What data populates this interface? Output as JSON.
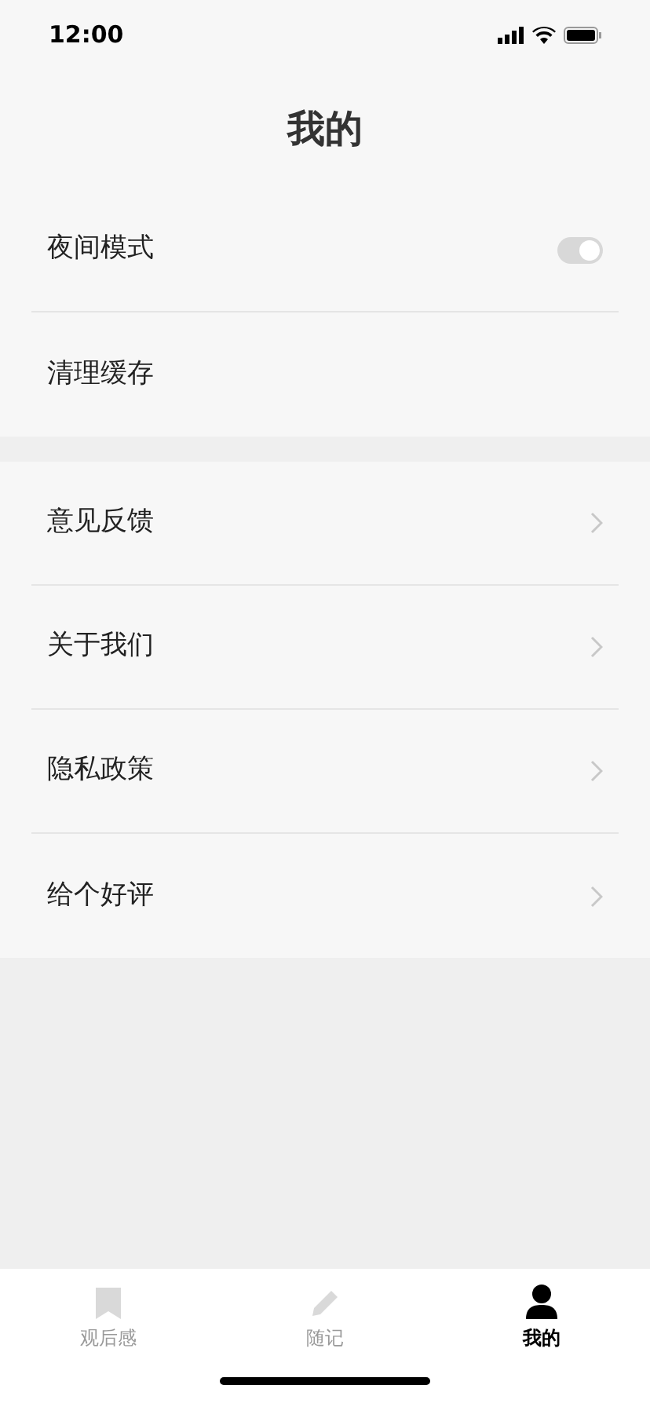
{
  "status_bar": {
    "time": "12:00"
  },
  "title": "我的",
  "sections": [
    {
      "items": [
        {
          "label": "夜间模式",
          "kind": "toggle",
          "on": true
        },
        {
          "label": "清理缓存",
          "kind": "plain"
        }
      ]
    },
    {
      "items": [
        {
          "label": "意见反馈",
          "kind": "link"
        },
        {
          "label": "关于我们",
          "kind": "link"
        },
        {
          "label": "隐私政策",
          "kind": "link"
        },
        {
          "label": "给个好评",
          "kind": "link"
        }
      ]
    }
  ],
  "tab_bar": [
    {
      "label": "观后感",
      "kind": "bookmark",
      "selected": false
    },
    {
      "label": "随记",
      "kind": "pencil",
      "selected": false
    },
    {
      "label": "我的",
      "kind": "person",
      "selected": true
    }
  ]
}
